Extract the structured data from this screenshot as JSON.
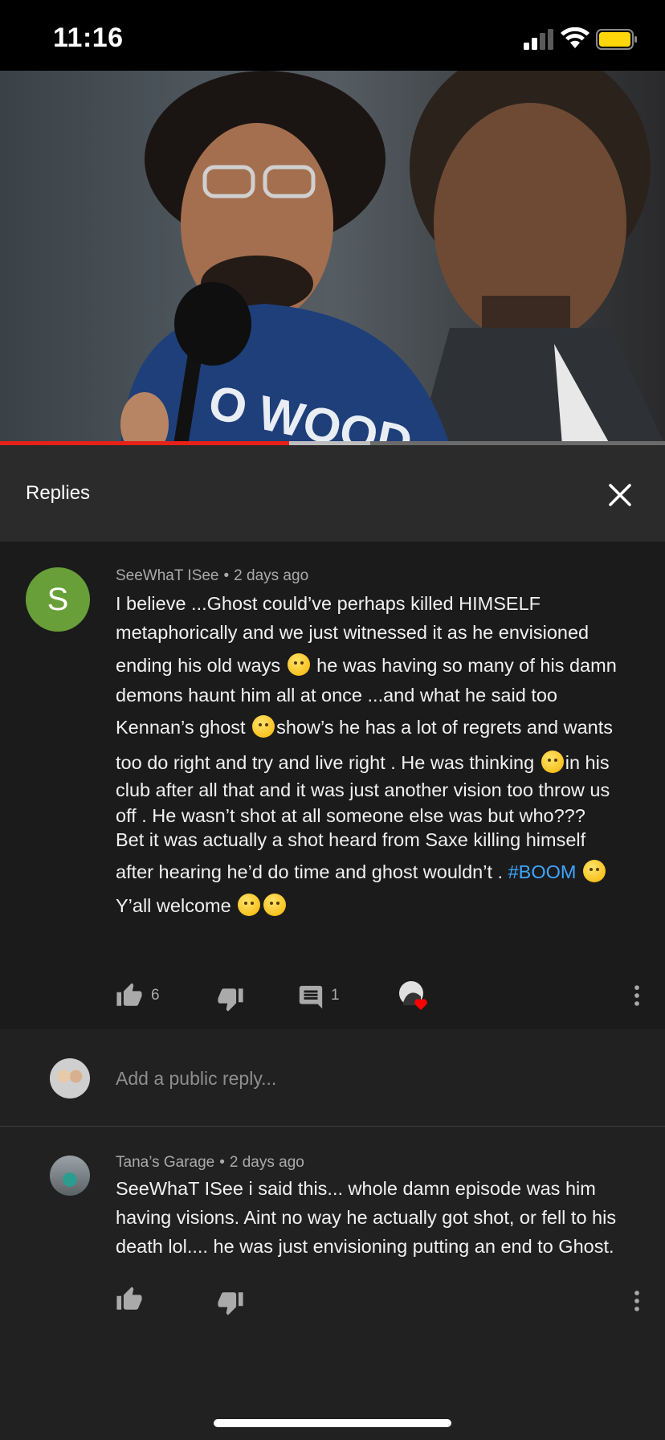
{
  "status_bar": {
    "time": "11:16"
  },
  "video": {
    "progress_played": 0.435,
    "progress_buffered": 0.557,
    "overlay_text": "O WOOD"
  },
  "replies_header": {
    "title": "Replies"
  },
  "main_comment": {
    "avatar_letter": "S",
    "author": "SeeWhaT ISee",
    "separator": "•",
    "time": "2 days ago",
    "lines": [
      "I believe ...Ghost could’ve perhaps killed HIMSELF",
      "metaphorically and we just witnessed it as he envisioned",
      "ending his old ways",
      "he was having so many of his damn",
      "demons haunt him all at once ...and what he said too",
      "Kennan’s ghost",
      "show’s he has a lot of regrets and wants",
      "too do right and try and live right .  He was thinking",
      "in his",
      "club after all that and it was just another vision too throw us",
      "off .   He wasn’t shot at all someone else was but who???",
      "Bet it was actually a shot heard from Saxe killing himself",
      "after hearing he’d do time and ghost wouldn’t .",
      "#BOOM",
      "Y’all welcome"
    ],
    "like_count": "6",
    "reply_count": "1"
  },
  "reply_input": {
    "placeholder": "Add a public reply..."
  },
  "reply_comment": {
    "author": "Tana’s Garage",
    "separator": "•",
    "time": "2 days ago",
    "lines": [
      "SeeWhaT ISee i said this... whole damn episode was him",
      "having visions. Aint no way he actually got shot, or fell to his",
      "death lol.... he was just envisioning putting an end to Ghost."
    ]
  },
  "colors": {
    "accent_red": "#e62117",
    "hashtag_blue": "#3ea6ff",
    "avatar_green": "#689f38",
    "battery_yellow": "#ffd60a"
  },
  "icons": [
    "signal-icon",
    "wifi-icon",
    "battery-icon",
    "close-icon",
    "thumb-up-icon",
    "thumb-down-icon",
    "comment-icon",
    "creator-heart-icon",
    "more-vert-icon"
  ]
}
